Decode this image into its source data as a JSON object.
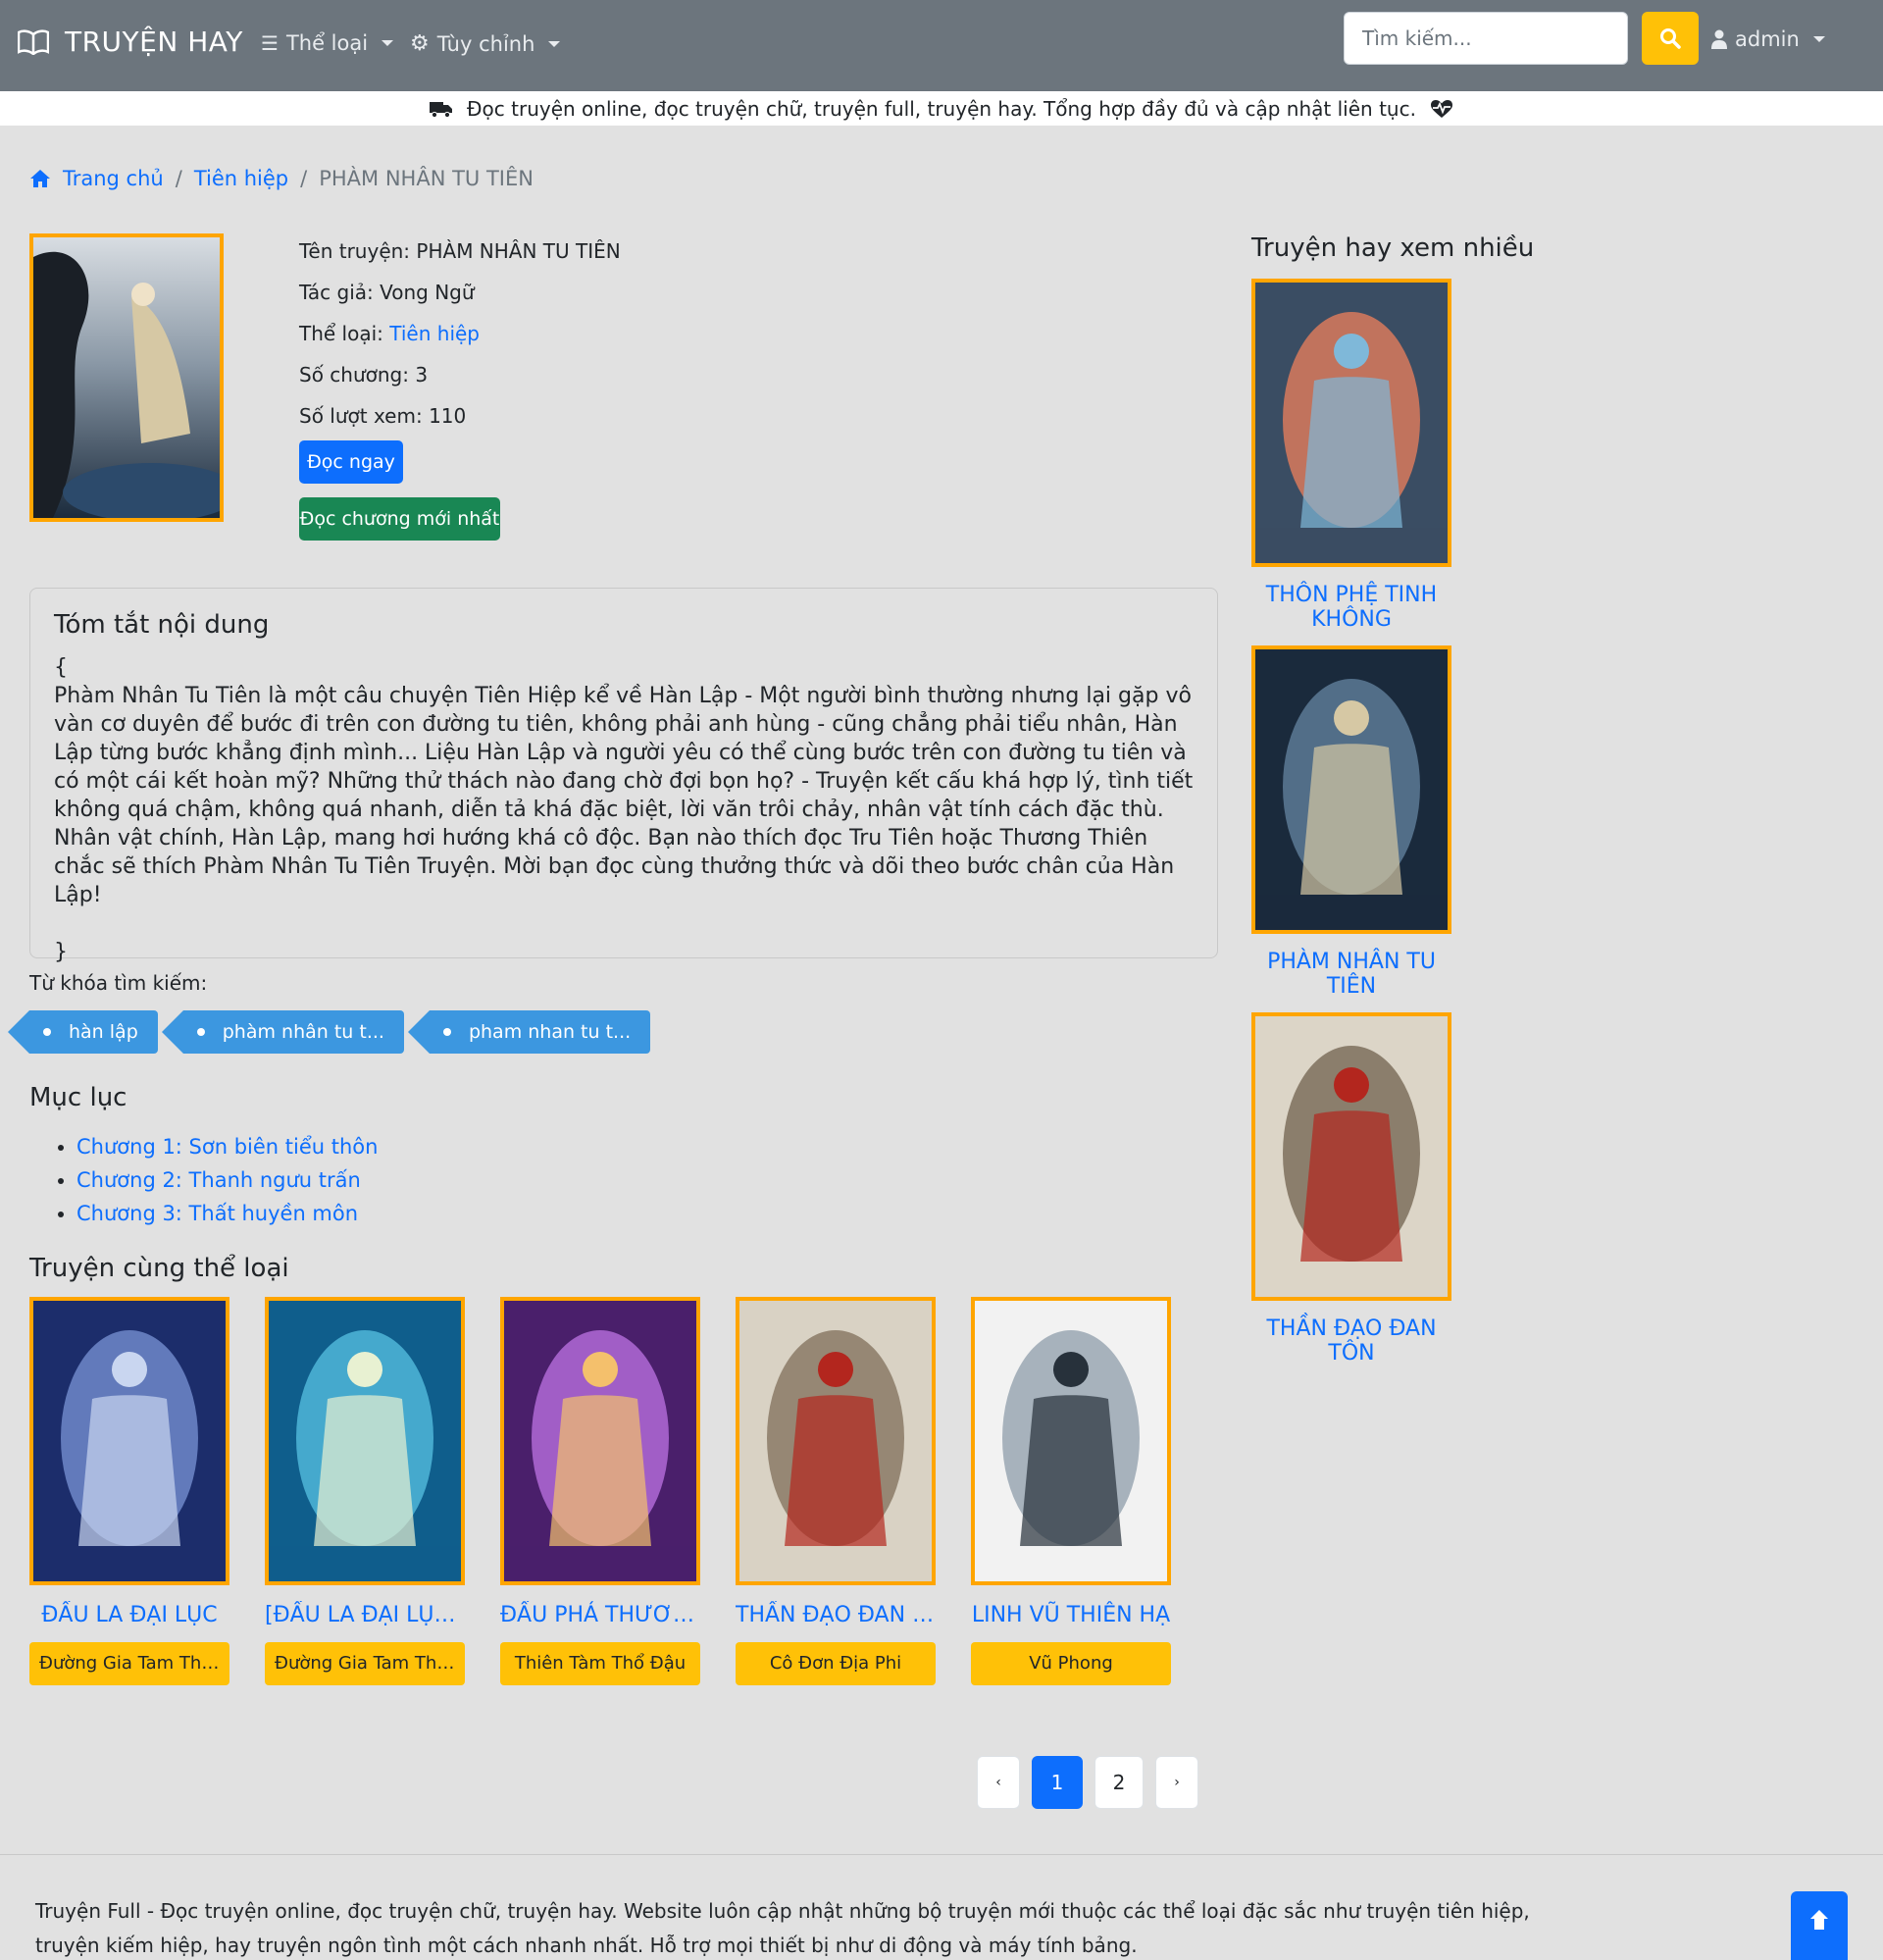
{
  "navbar": {
    "brand": "TRUYỆN HAY",
    "genre_menu": "Thể loại",
    "custom_menu": "Tùy chỉnh",
    "search_placeholder": "Tìm kiếm...",
    "user": "admin"
  },
  "tagline": "Đọc truyện online, đọc truyện chữ, truyện full, truyện hay. Tổng hợp đầy đủ và cập nhật liên tục.",
  "breadcrumb": {
    "home": "Trang chủ",
    "category": "Tiên hiệp",
    "current": "PHÀM NHÂN TU TIÊN"
  },
  "story": {
    "name_label": "Tên truyện:",
    "name": "PHÀM NHÂN TU TIÊN",
    "author_label": "Tác giả:",
    "author": "Vong Ngữ",
    "genre_label": "Thể loại:",
    "genre": "Tiên hiệp",
    "chapters_label": "Số chương:",
    "chapters": "3",
    "views_label": "Số lượt xem:",
    "views": "110",
    "read_now": "Đọc ngay",
    "read_latest": "Đọc chương mới nhất"
  },
  "summary": {
    "title": "Tóm tắt nội dung",
    "text": "{\nPhàm Nhân Tu Tiên là một câu chuyện Tiên Hiệp kể về Hàn Lập - Một người bình thường nhưng lại gặp vô vàn cơ duyên để bước đi trên con đường tu tiên, không phải anh hùng - cũng chẳng phải tiểu nhân, Hàn Lập từng bước khẳng định mình... Liệu Hàn Lập và người yêu có thể cùng bước trên con đường tu tiên và có một cái kết hoàn mỹ? Những thử thách nào đang chờ đợi bọn họ? - Truyện kết cấu khá hợp lý, tình tiết không quá chậm, không quá nhanh, diễn tả khá đặc biệt, lời văn trôi chảy, nhân vật tính cách đặc thù. Nhân vật chính, Hàn Lập, mang hơi hướng khá cô độc. Bạn nào thích đọc Tru Tiên hoặc Thương Thiên chắc sẽ thích Phàm Nhân Tu Tiên Truyện. Mời bạn đọc cùng thưởng thức và dõi theo bước chân của Hàn Lập!\n\n}"
  },
  "keywords": {
    "label": "Từ khóa tìm kiếm:",
    "tags": [
      "hàn lập",
      "phàm nhân tu t...",
      "pham nhan tu t..."
    ]
  },
  "toc": {
    "title": "Mục lục",
    "chapters": [
      "Chương 1: Sơn biên tiểu thôn",
      "Chương 2: Thanh ngưu trấn",
      "Chương 3: Thất huyền môn"
    ]
  },
  "same_genre": {
    "title": "Truyện cùng thể loại",
    "items": [
      {
        "title": "ĐẤU LA ĐẠI LỤC",
        "author": "Đường Gia Tam Thi...",
        "c1": "#1c2d6b",
        "c2": "#6f88c9",
        "c3": "#c9d6f0"
      },
      {
        "title": "[ĐẤU LA ĐẠI LỤC ...",
        "author": "Đường Gia Tam Thi...",
        "c1": "#0f5e8c",
        "c2": "#4fb6d8",
        "c3": "#e8f1d2"
      },
      {
        "title": "ĐẤU PHÁ THƯƠN...",
        "author": "Thiên Tàm Thổ Đậu",
        "c1": "#4a1f6b",
        "c2": "#b06ad6",
        "c3": "#f4c06c"
      },
      {
        "title": "THẦN ĐẠO ĐAN T...",
        "author": "Cô Đơn Địa Phi",
        "c1": "#d9d2c4",
        "c2": "#8a7a66",
        "c3": "#b3261e"
      },
      {
        "title": "LINH VŨ THIÊN HẠ",
        "author": "Vũ Phong",
        "c1": "#f2f2f2",
        "c2": "#9aa7b3",
        "c3": "#27313b"
      }
    ]
  },
  "pagination": {
    "prev": "‹",
    "pages": [
      "1",
      "2"
    ],
    "next": "›"
  },
  "sidebar": {
    "title": "Truyện hay xem nhiều",
    "items": [
      {
        "title": "THÔN PHỆ TINH KHÔNG",
        "c1": "#3a4d63",
        "c2": "#d97a5c",
        "c3": "#7fb8d9"
      },
      {
        "title": "PHÀM NHÂN TU TIÊN",
        "c1": "#1a2a3c",
        "c2": "#5d7a95",
        "c3": "#d6c8a4"
      },
      {
        "title": "THẦN ĐẠO ĐAN TÔN",
        "c1": "#dcd5c7",
        "c2": "#7c6e5c",
        "c3": "#b3261e"
      }
    ]
  },
  "footer": {
    "text": "Truyện Full - Đọc truyện online, đọc truyện chữ, truyện hay. Website luôn cập nhật những bộ truyện mới thuộc các thể loại đặc sắc như truyện tiên hiệp, truyện kiếm hiệp, hay truyện ngôn tình một cách nhanh nhất. Hỗ trợ mọi thiết bị như di động và máy tính bảng."
  },
  "colors": {
    "navbar": "#6c757d",
    "accent": "#0d6efd",
    "cover_border": "#ffa500",
    "author_badge": "#ffc107",
    "success": "#198754"
  }
}
